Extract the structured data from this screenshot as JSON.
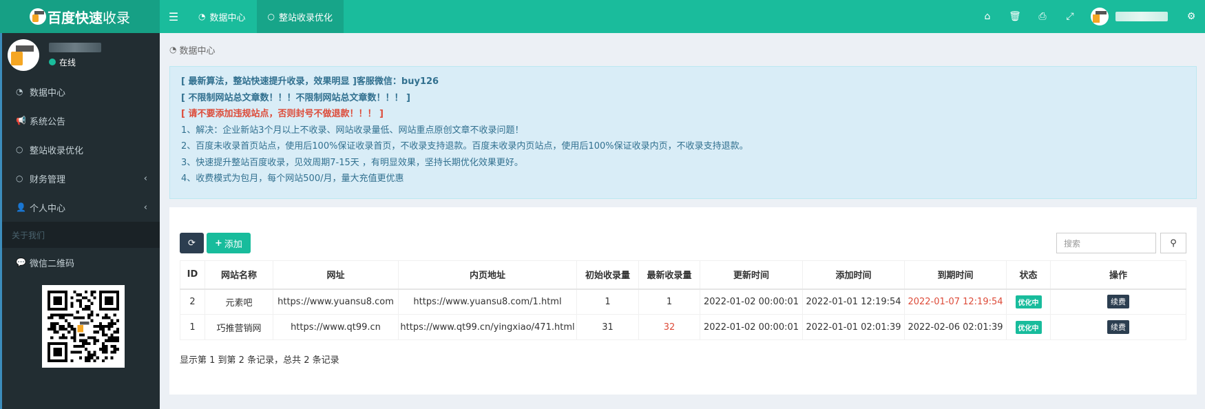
{
  "logo": {
    "title_bold": "百度快速",
    "title_rest": "收录"
  },
  "topbar": {
    "tabs": [
      {
        "label": "数据中心",
        "icon": "dashboard-icon"
      },
      {
        "label": "整站收录优化",
        "icon": "circle-icon"
      }
    ],
    "right_icons": [
      "home-icon",
      "trash-icon",
      "translate-icon",
      "fullscreen-icon",
      "settings-icon"
    ]
  },
  "sidebar": {
    "status": "在线",
    "items": [
      {
        "label": "数据中心",
        "icon": "dashboard-icon"
      },
      {
        "label": "系统公告",
        "icon": "bullhorn-icon"
      },
      {
        "label": "整站收录优化",
        "icon": "circle-icon"
      },
      {
        "label": "财务管理",
        "icon": "circle-icon"
      },
      {
        "label": "个人中心",
        "icon": "user-icon"
      }
    ],
    "header": "关于我们",
    "wechat_label": "微信二维码"
  },
  "breadcrumb": "数据中心",
  "notice": {
    "line1": "[ 最新算法，整站快速提升收录，效果明显 ]客服微信：buy126",
    "line2": "[ 不限制网站总文章数！！！不限制网站总文章数！！！ ]",
    "line3": "[ 请不要添加违规站点，否则封号不做退款！！！ ]",
    "line4": "1、解决：企业新站3个月以上不收录、网站收录量低、网站重点原创文章不收录问题！",
    "line5": "2、百度未收录首页站点，使用后100%保证收录首页，不收录支持退款。百度未收录内页站点，使用后100%保证收录内页，不收录支持退款。",
    "line6": "3、快速提升整站百度收录，见效周期7-15天 ，有明显效果，坚持长期优化效果更好。",
    "line7": "4、收费模式为包月，每个网站500/月，量大充值更优惠"
  },
  "toolbar": {
    "add_label": "添加",
    "search_placeholder": "搜索"
  },
  "table": {
    "headers": [
      "ID",
      "网站名称",
      "网址",
      "内页地址",
      "初始收录量",
      "最新收录量",
      "更新时间",
      "添加时间",
      "到期时间",
      "状态",
      "操作"
    ],
    "rows": [
      {
        "id": "2",
        "name": "元素吧",
        "url": "https://www.yuansu8.com",
        "inner": "https://www.yuansu8.com/1.html",
        "init": "1",
        "latest": "1",
        "updated": "2022-01-02 00:00:01",
        "added": "2022-01-01 12:19:54",
        "expire": "2022-01-07 12:19:54",
        "status": "优化中",
        "action": "续费"
      },
      {
        "id": "1",
        "name": "巧推营销网",
        "url": "https://www.qt99.cn",
        "inner": "https://www.qt99.cn/yingxiao/471.html",
        "init": "31",
        "latest": "32",
        "updated": "2022-01-02 00:00:01",
        "added": "2022-01-01 02:01:39",
        "expire": "2022-02-06 02:01:39",
        "status": "优化中",
        "action": "续费"
      }
    ],
    "summary": "显示第 1 到第 2 条记录，总共 2 条记录"
  },
  "colors": {
    "primary": "#1abc9c",
    "sidebar_bg": "#222d32",
    "alert_red": "#dd4b39",
    "dark_button": "#2c3e50"
  }
}
